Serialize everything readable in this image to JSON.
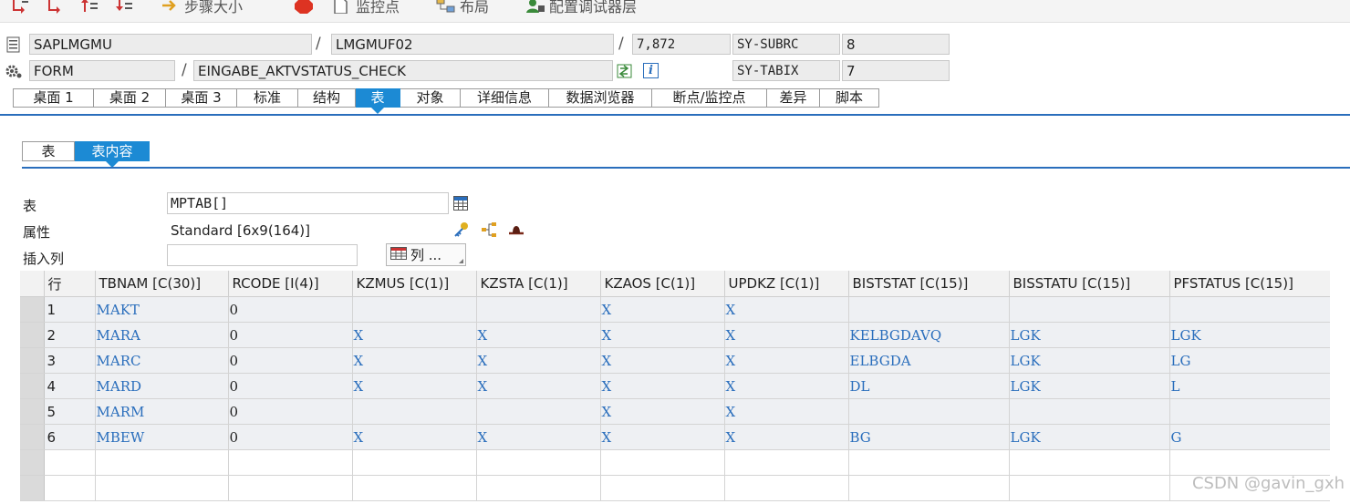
{
  "toolbar": {
    "items": [
      {
        "label": ""
      },
      {
        "label": ""
      },
      {
        "label": ""
      },
      {
        "label": ""
      },
      {
        "label": "步骤大小"
      },
      {
        "label": ""
      },
      {
        "label": "监控点"
      },
      {
        "label": "布局"
      },
      {
        "label": "配置调试器层"
      }
    ]
  },
  "header": {
    "program": "SAPLMGMU",
    "include": "LMGMUF02",
    "line": "7,872",
    "type": "FORM",
    "routine": "EINGABE_AKTVSTATUS_CHECK",
    "var1_name": "SY-SUBRC",
    "var1_value": "8",
    "var2_name": "SY-TABIX",
    "var2_value": "7",
    "slash": "/",
    "info_icon": "i"
  },
  "tabs": [
    "桌面 1",
    "桌面 2",
    "桌面 3",
    "标准",
    "结构",
    "表",
    "对象",
    "详细信息",
    "数据浏览器",
    "断点/监控点",
    "差异",
    "脚本"
  ],
  "subtabs": [
    "表",
    "表内容"
  ],
  "form": {
    "table_label": "表",
    "table_value": "MPTAB[]",
    "attr_label": "属性",
    "attr_value": "Standard [6x9(164)]",
    "insert_label": "插入列",
    "insert_value": "",
    "columns_button": "列 ..."
  },
  "grid": {
    "headers": [
      "行",
      "TBNAM [C(30)]",
      "RCODE [I(4)]",
      "KZMUS [C(1)]",
      "KZSTA [C(1)]",
      "KZAOS [C(1)]",
      "UPDKZ [C(1)]",
      "BISTSTAT [C(15)]",
      "BISSTATU [C(15)]",
      "PFSTATUS [C(15)]"
    ],
    "rows": [
      [
        "1",
        "MAKT",
        "0",
        "",
        "",
        "X",
        "X",
        "",
        "",
        ""
      ],
      [
        "2",
        "MARA",
        "0",
        "X",
        "X",
        "X",
        "X",
        "KELBGDAVQ",
        "LGK",
        "LGK"
      ],
      [
        "3",
        "MARC",
        "0",
        "X",
        "X",
        "X",
        "X",
        "ELBGDA",
        "LGK",
        "LG"
      ],
      [
        "4",
        "MARD",
        "0",
        "X",
        "X",
        "X",
        "X",
        "DL",
        "LGK",
        "L"
      ],
      [
        "5",
        "MARM",
        "0",
        "",
        "",
        "X",
        "X",
        "",
        "",
        ""
      ],
      [
        "6",
        "MBEW",
        "0",
        "X",
        "X",
        "X",
        "X",
        "BG",
        "LGK",
        "G"
      ]
    ]
  },
  "watermark": "CSDN @gavin_gxh",
  "colors": {
    "accent": "#1c8ad4",
    "cell_value": "#2a6ebc"
  }
}
